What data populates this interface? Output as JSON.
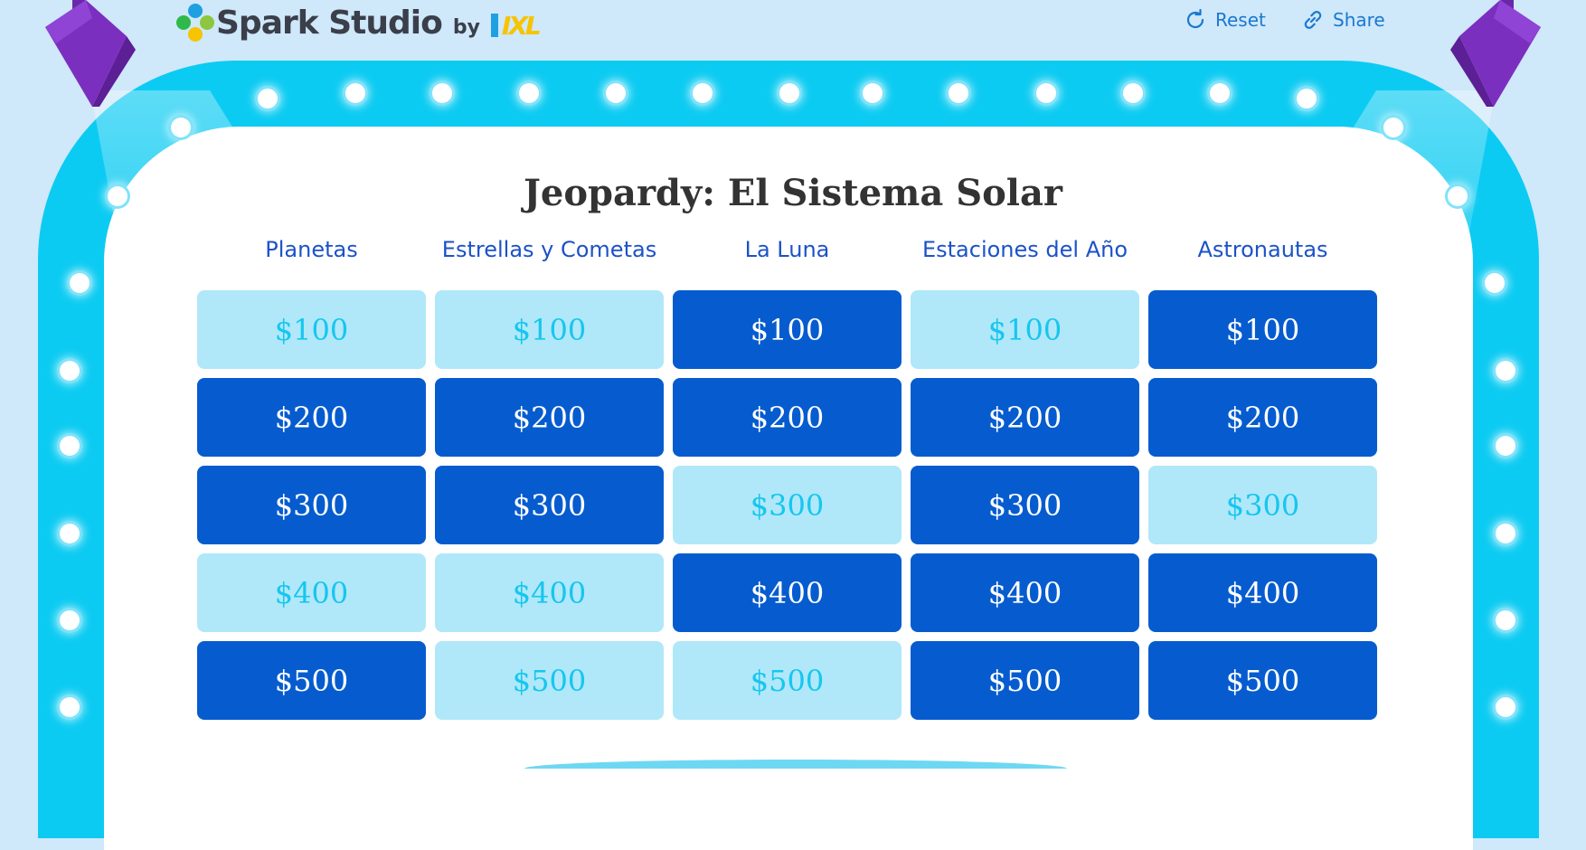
{
  "header": {
    "brand": "Spark Studio",
    "by": "by",
    "partner": "IXL",
    "reset_label": "Reset",
    "share_label": "Share"
  },
  "game": {
    "title": "Jeopardy: El Sistema Solar",
    "categories": [
      "Planetas",
      "Estrellas y Cometas",
      "La Luna",
      "Estaciones del Año",
      "Astronautas"
    ],
    "rows": [
      [
        {
          "value": "$100",
          "used": true
        },
        {
          "value": "$100",
          "used": true
        },
        {
          "value": "$100",
          "used": false
        },
        {
          "value": "$100",
          "used": true
        },
        {
          "value": "$100",
          "used": false
        }
      ],
      [
        {
          "value": "$200",
          "used": false
        },
        {
          "value": "$200",
          "used": false
        },
        {
          "value": "$200",
          "used": false
        },
        {
          "value": "$200",
          "used": false
        },
        {
          "value": "$200",
          "used": false
        }
      ],
      [
        {
          "value": "$300",
          "used": false
        },
        {
          "value": "$300",
          "used": false
        },
        {
          "value": "$300",
          "used": true
        },
        {
          "value": "$300",
          "used": false
        },
        {
          "value": "$300",
          "used": true
        }
      ],
      [
        {
          "value": "$400",
          "used": true
        },
        {
          "value": "$400",
          "used": true
        },
        {
          "value": "$400",
          "used": false
        },
        {
          "value": "$400",
          "used": false
        },
        {
          "value": "$400",
          "used": false
        }
      ],
      [
        {
          "value": "$500",
          "used": false
        },
        {
          "value": "$500",
          "used": true
        },
        {
          "value": "$500",
          "used": true
        },
        {
          "value": "$500",
          "used": false
        },
        {
          "value": "$500",
          "used": false
        }
      ]
    ]
  },
  "colors": {
    "background": "#cfe8fa",
    "frame": "#0ccbf2",
    "tile_active": "#065ccf",
    "tile_used": "#b0e8f9",
    "tile_used_text": "#17c6ef",
    "category_text": "#1c52c8",
    "header_link": "#1a78d0",
    "lamp": "#7b2fbf"
  },
  "icons": {
    "logo": "flower-logo-icon",
    "reset": "refresh-icon",
    "share": "link-icon",
    "lamp": "stage-spotlight-icon"
  }
}
